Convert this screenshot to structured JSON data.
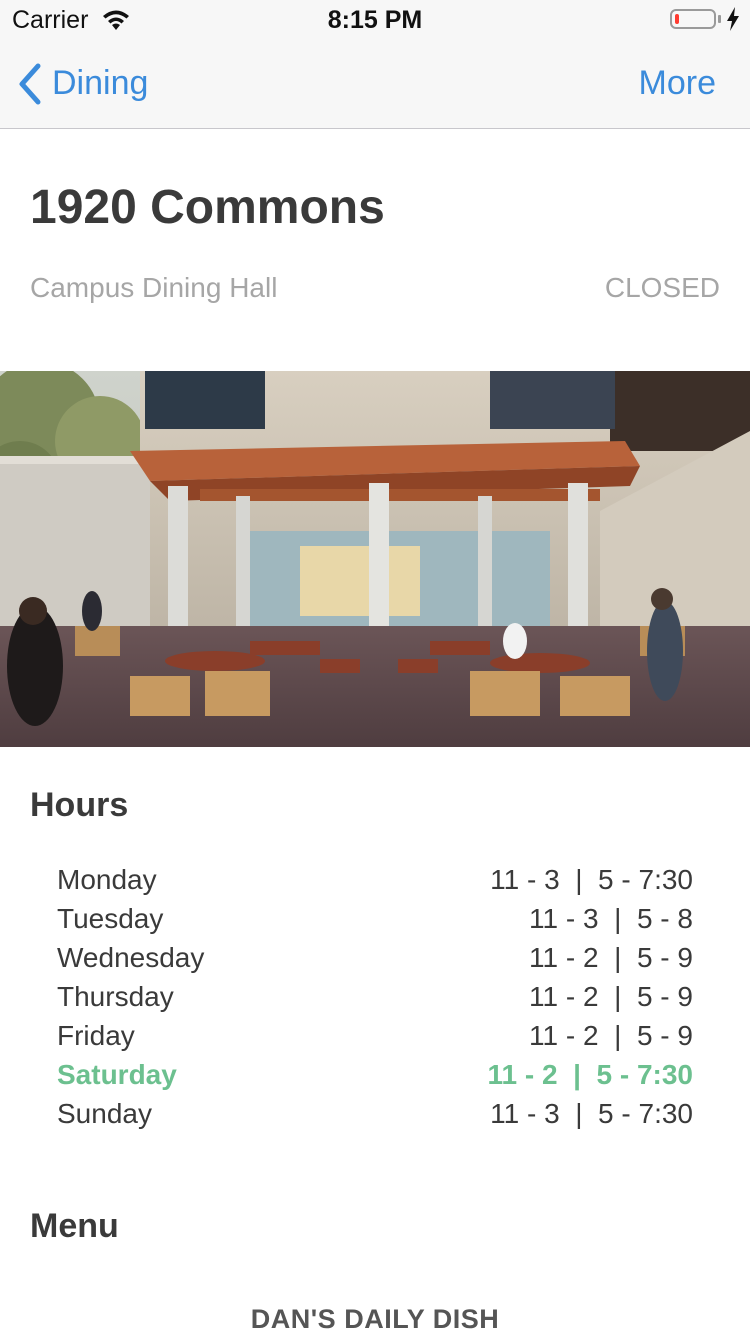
{
  "status_bar": {
    "carrier": "Carrier",
    "time": "8:15 PM",
    "battery_level": 0.12
  },
  "nav": {
    "back_label": "Dining",
    "more_label": "More"
  },
  "header": {
    "title": "1920 Commons",
    "subtitle": "Campus Dining Hall",
    "status": "CLOSED"
  },
  "hero_image": {
    "description_icon": "photo-dining-terrace"
  },
  "hours": {
    "heading": "Hours",
    "rows": [
      {
        "day": "Monday",
        "time": "11 - 3  |  5 - 7:30"
      },
      {
        "day": "Tuesday",
        "time": "11 - 3  |  5 - 8"
      },
      {
        "day": "Wednesday",
        "time": "11 - 2  |  5 - 9"
      },
      {
        "day": "Thursday",
        "time": "11 - 2  |  5 - 9"
      },
      {
        "day": "Friday",
        "time": "11 - 2  |  5 - 9"
      },
      {
        "day": "Saturday",
        "time": "11 - 2  |  5 - 7:30"
      },
      {
        "day": "Sunday",
        "time": "11 - 3  |  5 - 7:30"
      }
    ],
    "today_index": 5
  },
  "menu": {
    "heading": "Menu",
    "section_title": "DAN'S DAILY DISH"
  },
  "colors": {
    "accent": "#3b8bdb",
    "today": "#6cc08f",
    "muted": "#a6a6a6",
    "text": "#3a3a3a"
  }
}
